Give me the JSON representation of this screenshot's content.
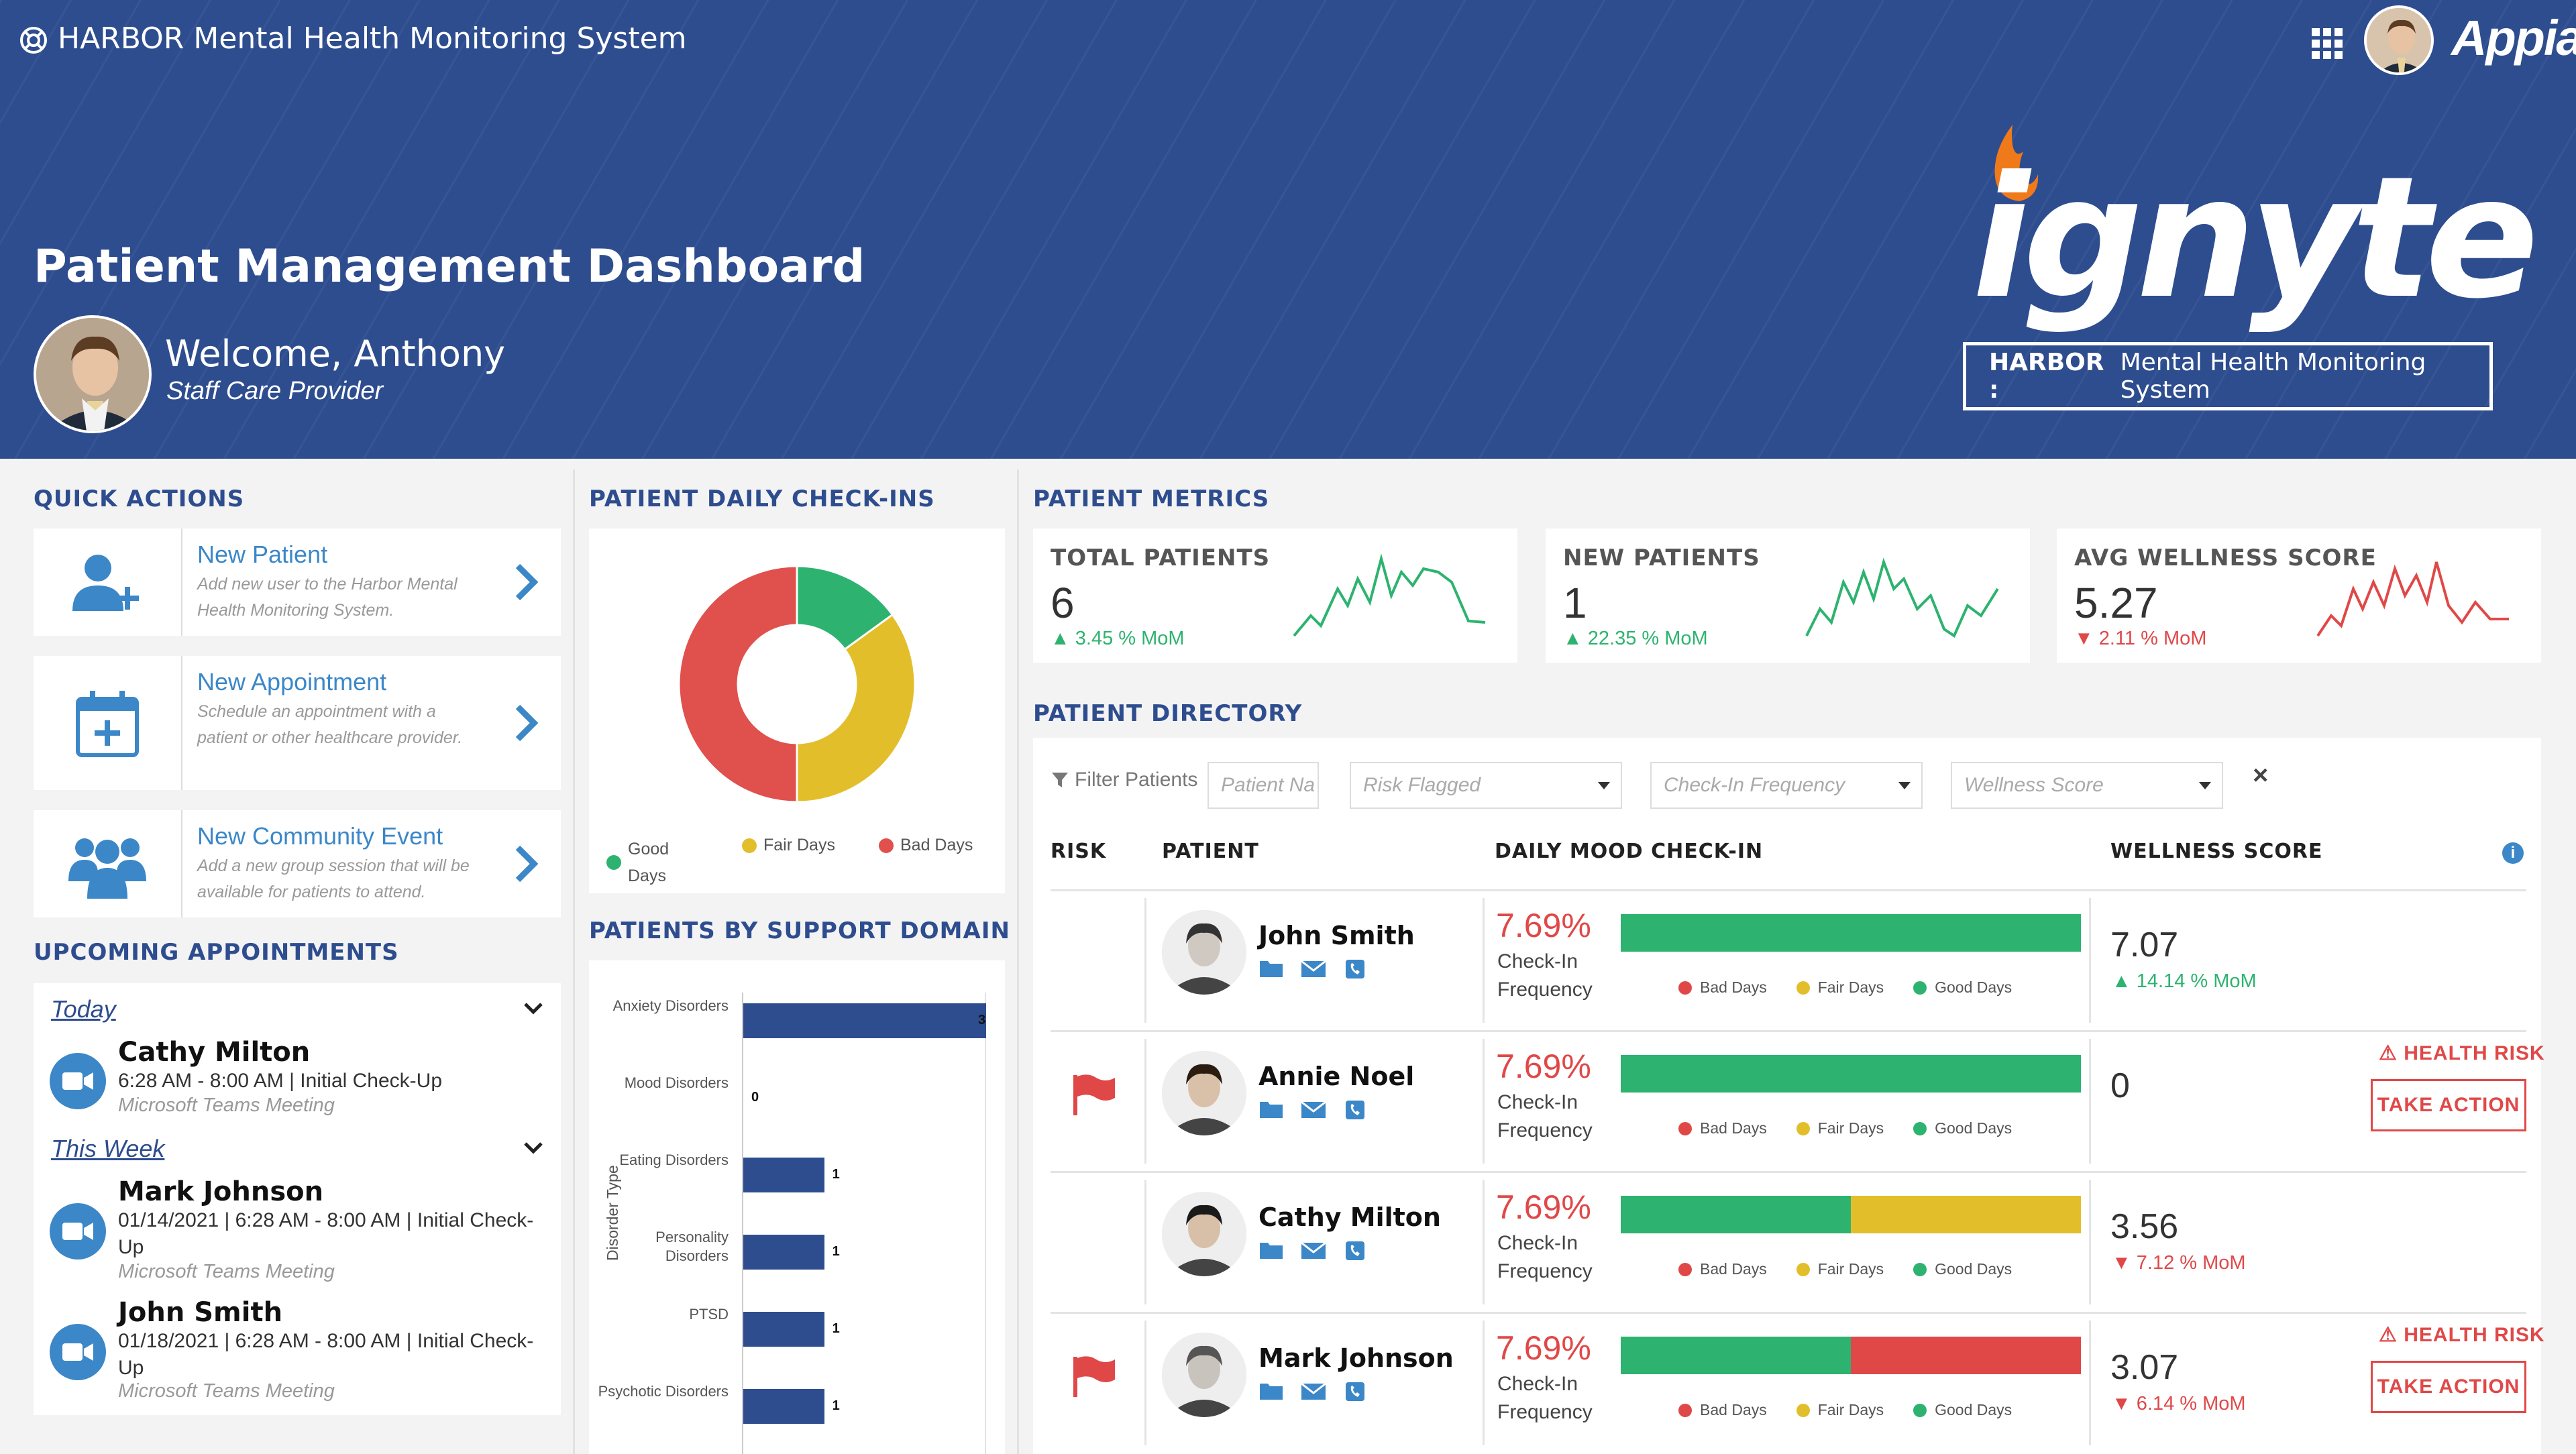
{
  "header": {
    "app_title": "HARBOR Mental Health Monitoring System",
    "brand": "Appian",
    "page_title": "Patient Management Dashboard",
    "welcome": "Welcome, Anthony",
    "role": "Staff Care Provider",
    "logo_text": "ignyte",
    "harbor_bold": "HARBOR :",
    "harbor_text": "Mental Health Monitoring System"
  },
  "quick_actions": {
    "title": "QUICK ACTIONS",
    "items": [
      {
        "label": "New Patient",
        "desc": "Add new user to the Harbor Mental Health Monitoring System."
      },
      {
        "label": "New Appointment",
        "desc": "Schedule an appointment with a patient or other healthcare provider."
      },
      {
        "label": "New Community Event",
        "desc": "Add a new group session that will be available for patients to attend."
      }
    ]
  },
  "appointments": {
    "title": "UPCOMING APPOINTMENTS",
    "groups": [
      {
        "label": "Today",
        "items": [
          {
            "name": "Cathy Milton",
            "time": "6:28 AM - 8:00 AM | Initial Check-Up",
            "location": "Microsoft Teams Meeting"
          }
        ]
      },
      {
        "label": "This Week",
        "items": [
          {
            "name": "Mark Johnson",
            "time": "01/14/2021 | 6:28 AM - 8:00 AM | Initial Check-Up",
            "location": "Microsoft Teams Meeting"
          },
          {
            "name": "John Smith",
            "time": "01/18/2021 | 6:28 AM - 8:00 AM | Initial Check-Up",
            "location": "Microsoft Teams Meeting"
          }
        ]
      }
    ]
  },
  "checkins": {
    "title": "PATIENT DAILY CHECK-INS",
    "legend": [
      "Good Days",
      "Fair Days",
      "Bad Days"
    ]
  },
  "chart_data": [
    {
      "type": "pie",
      "title": "",
      "categories": [
        "Good Days",
        "Fair Days",
        "Bad Days"
      ],
      "values": [
        15,
        35,
        50
      ],
      "colors": [
        "#2db36f",
        "#e3be2b",
        "#e0504d"
      ]
    },
    {
      "type": "bar",
      "orientation": "horizontal",
      "title": "PATIENTS BY SUPPORT DOMAIN",
      "ylabel": "Disorder Type",
      "categories": [
        "Anxiety Disorders",
        "Mood Disorders",
        "Eating Disorders",
        "Personality Disorders",
        "PTSD",
        "Psychotic Disorders"
      ],
      "values": [
        3,
        0,
        1,
        1,
        1,
        1
      ],
      "xlim": [
        0,
        3
      ]
    }
  ],
  "metrics": {
    "title": "PATIENT METRICS",
    "items": [
      {
        "label": "TOTAL PATIENTS",
        "value": "6",
        "delta": "3.45 % MoM",
        "dir": "up"
      },
      {
        "label": "NEW PATIENTS",
        "value": "1",
        "delta": "22.35 % MoM",
        "dir": "up"
      },
      {
        "label": "AVG WELLNESS SCORE",
        "value": "5.27",
        "delta": "2.11 % MoM",
        "dir": "down"
      }
    ]
  },
  "directory": {
    "title": "PATIENT DIRECTORY",
    "filter_label": "Filter Patients",
    "filters": {
      "name_placeholder": "Patient Na",
      "risk_placeholder": "Risk Flagged",
      "freq_placeholder": "Check-In Frequency",
      "wellness_placeholder": "Wellness Score"
    },
    "clear": "×",
    "columns": [
      "RISK",
      "PATIENT",
      "DAILY MOOD CHECK-IN",
      "WELLNESS SCORE"
    ],
    "legend": [
      "Bad Days",
      "Fair Days",
      "Good Days"
    ],
    "freq_label": "Check-In Frequency",
    "risk_label": "HEALTH RISK",
    "action_label": "TAKE ACTION",
    "rows": [
      {
        "name": "John Smith",
        "pct": "7.69%",
        "good": 1.0,
        "fair": 0,
        "bad": 0,
        "score": "7.07",
        "delta": "14.14 % MoM",
        "dir": "up",
        "flag": false
      },
      {
        "name": "Annie Noel",
        "pct": "7.69%",
        "good": 1.0,
        "fair": 0,
        "bad": 0,
        "score": "0",
        "delta": "",
        "dir": "",
        "flag": true
      },
      {
        "name": "Cathy Milton",
        "pct": "7.69%",
        "good": 0.5,
        "fair": 0.5,
        "bad": 0,
        "score": "3.56",
        "delta": "7.12 % MoM",
        "dir": "down",
        "flag": false
      },
      {
        "name": "Mark Johnson",
        "pct": "7.69%",
        "good": 0.5,
        "fair": 0,
        "bad": 0.5,
        "score": "3.07",
        "delta": "6.14 % MoM",
        "dir": "down",
        "flag": true
      }
    ]
  },
  "colors": {
    "header_bg": "#2e4d8f",
    "accent": "#3b87c8",
    "good": "#2db36f",
    "fair": "#e3be2b",
    "bad": "#e04848"
  }
}
